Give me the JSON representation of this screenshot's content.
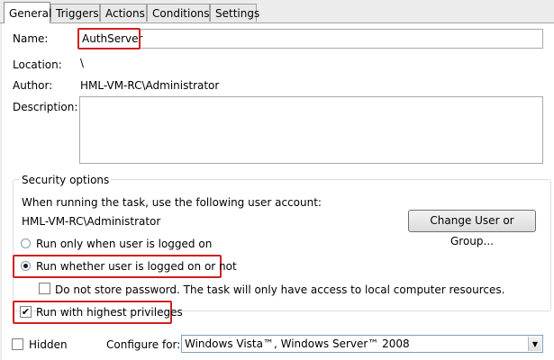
{
  "tabs": [
    "General",
    "Triggers",
    "Actions",
    "Conditions",
    "Settings"
  ],
  "general": {
    "name_label": "Name:",
    "name_value": "AuthServer",
    "location_label": "Location:",
    "location_value": "\\",
    "author_label": "Author:",
    "author_value": "HML-VM-RC\\Administrator",
    "description_label": "Description:",
    "description_value": ""
  },
  "security": {
    "title": "Security options",
    "account_prompt": "When running the task, use the following user account:",
    "account_value": "HML-VM-RC\\Administrator",
    "change_button": "Change User or Group...",
    "radio_logged_on": "Run only when user is logged on",
    "radio_whether": "Run whether user is logged on or not",
    "do_not_store": "Do not store password.  The task will only have access to local computer resources.",
    "highest_privileges": "Run with highest privileges",
    "selected_radio": "whether",
    "highest_privileges_checked": true,
    "do_not_store_checked": false
  },
  "footer": {
    "hidden_label": "Hidden",
    "hidden_checked": false,
    "configure_label": "Configure for:",
    "configure_value": "Windows Vista™, Windows Server™ 2008"
  },
  "colors": {
    "highlight": "#d21f1f",
    "panel": "#ffffff",
    "chrome": "#ececec"
  }
}
